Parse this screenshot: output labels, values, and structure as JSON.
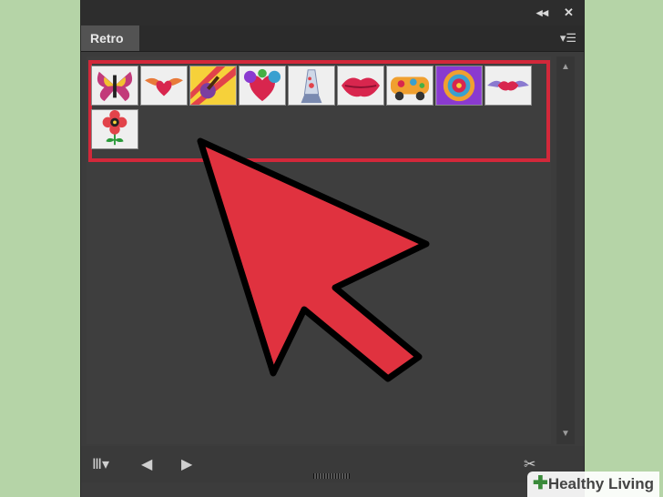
{
  "panel": {
    "tab_label": "Retro",
    "collapse_icon": "double-chevron-left-icon",
    "close_icon": "close-icon",
    "menu_icon": "panel-menu-icon"
  },
  "symbols": [
    {
      "name": "butterfly"
    },
    {
      "name": "winged-heart"
    },
    {
      "name": "guitar"
    },
    {
      "name": "heart-with-flowers"
    },
    {
      "name": "lava-lamp"
    },
    {
      "name": "lips"
    },
    {
      "name": "hippie-van"
    },
    {
      "name": "tie-dye-peace"
    },
    {
      "name": "flying-lips"
    },
    {
      "name": "peace-flower"
    }
  ],
  "bottom_toolbar": {
    "library_menu_icon": "symbol-library-menu-icon",
    "previous_icon": "previous-library-icon",
    "next_icon": "next-library-icon",
    "break_link_icon": "break-link-icon"
  },
  "watermark": {
    "text": "Healthy Living"
  },
  "colors": {
    "highlight": "#d2283a",
    "arrow_fill": "#e0323f",
    "panel_bg": "#3c3c3c"
  }
}
